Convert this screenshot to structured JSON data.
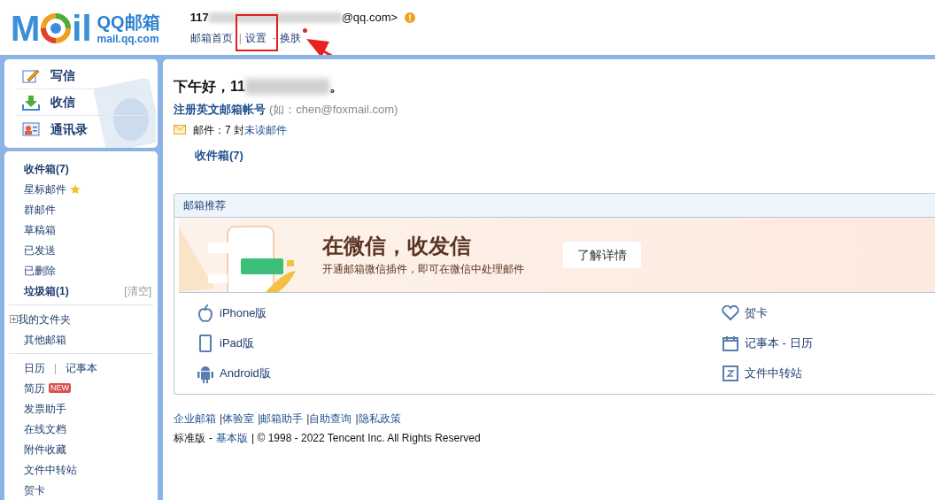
{
  "header": {
    "logo": {
      "letters_left": "M",
      "letters_right": "il",
      "name": "QQ邮箱",
      "domain": "mail.qq.com"
    },
    "account": {
      "visible_start": "117",
      "visible_end": "@qq.com>"
    },
    "nav": [
      {
        "kind": "link",
        "label": "邮箱首页"
      },
      {
        "kind": "separator",
        "label": "|"
      },
      {
        "kind": "link",
        "label": "设置"
      },
      {
        "kind": "separator",
        "label": "-"
      },
      {
        "kind": "link",
        "label": "换肤",
        "dot": true
      }
    ]
  },
  "sidebar": {
    "actions": [
      {
        "kind": "compose",
        "label": "写信"
      },
      {
        "kind": "receive",
        "label": "收信"
      },
      {
        "kind": "contacts",
        "label": "通讯录"
      }
    ],
    "folders": [
      {
        "label": "收件箱(7)",
        "bold": true
      },
      {
        "label": "星标邮件",
        "starred": true,
        "bold": false
      },
      {
        "label": "群邮件",
        "bold": false
      },
      {
        "label": "草稿箱",
        "bold": false
      },
      {
        "label": "已发送",
        "bold": false
      },
      {
        "label": "已删除",
        "bold": false
      },
      {
        "label": "垃圾箱(1)",
        "bold": true,
        "action": "[清空]"
      }
    ],
    "groups": [
      {
        "label": "我的文件夹",
        "expandable": true
      },
      {
        "label": "其他邮箱",
        "expandable": false
      }
    ],
    "tools": [
      {
        "label": "日历",
        "separator": "|",
        "second": "记事本"
      },
      {
        "label": "简历",
        "badge": "NEW"
      },
      {
        "label": "发票助手"
      },
      {
        "label": "在线文档"
      },
      {
        "label": "附件收藏"
      },
      {
        "label": "文件中转站"
      },
      {
        "label": "贺卡"
      }
    ]
  },
  "main": {
    "greeting_start": "下午好，11",
    "greeting_end": "。",
    "register_link": "注册英文邮箱帐号",
    "register_hint": "(如：chen@foxmail.com)",
    "mail_count": "邮件：7 封",
    "unread_link": "未读邮件",
    "inbox_link": "收件箱(7)",
    "recommend": {
      "title": "邮箱推荐",
      "banner": {
        "title": "在微信，收发信",
        "subtitle": "开通邮箱微信插件，即可在微信中处理邮件",
        "button": "了解详情"
      },
      "left_links": [
        {
          "kind": "apple",
          "label": "iPhone版"
        },
        {
          "kind": "tablet",
          "label": "iPad版"
        },
        {
          "kind": "android",
          "label": "Android版"
        }
      ],
      "right_links": [
        {
          "kind": "heart",
          "label": "贺卡"
        },
        {
          "kind": "calendar",
          "label": "记事本 - 日历"
        },
        {
          "kind": "transfer",
          "label": "文件中转站"
        }
      ]
    }
  },
  "footer": {
    "links": [
      "企业邮箱",
      "体验室",
      "邮箱助手",
      "自助查询",
      "隐私政策"
    ],
    "separator": "|",
    "edition": "标准版",
    "dash": "-",
    "basic_link": "基本版",
    "copyright": "| © 1998 - 2022 Tencent Inc. All Rights Reserved"
  }
}
